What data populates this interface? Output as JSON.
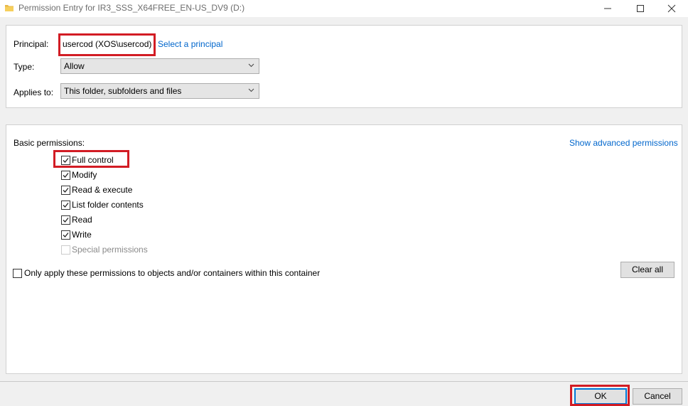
{
  "window": {
    "title": "Permission Entry for IR3_SSS_X64FREE_EN-US_DV9 (D:)",
    "icon": "folder-icon"
  },
  "principal": {
    "label": "Principal:",
    "value": "usercod (XOS\\usercod)",
    "select_link": "Select a principal"
  },
  "type": {
    "label": "Type:",
    "value": "Allow"
  },
  "applies_to": {
    "label": "Applies to:",
    "value": "This folder, subfolders and files"
  },
  "permissions": {
    "heading": "Basic permissions:",
    "advanced_link": "Show advanced permissions",
    "items": [
      {
        "label": "Full control",
        "checked": true,
        "enabled": true
      },
      {
        "label": "Modify",
        "checked": true,
        "enabled": true
      },
      {
        "label": "Read & execute",
        "checked": true,
        "enabled": true
      },
      {
        "label": "List folder contents",
        "checked": true,
        "enabled": true
      },
      {
        "label": "Read",
        "checked": true,
        "enabled": true
      },
      {
        "label": "Write",
        "checked": true,
        "enabled": true
      },
      {
        "label": "Special permissions",
        "checked": false,
        "enabled": false
      }
    ],
    "only_apply_label": "Only apply these permissions to objects and/or containers within this container",
    "only_apply_checked": false,
    "clear_all": "Clear all"
  },
  "buttons": {
    "ok": "OK",
    "cancel": "Cancel"
  },
  "colors": {
    "highlight": "#d21c24",
    "link": "#0066cc",
    "default_button_border": "#0078d7"
  }
}
